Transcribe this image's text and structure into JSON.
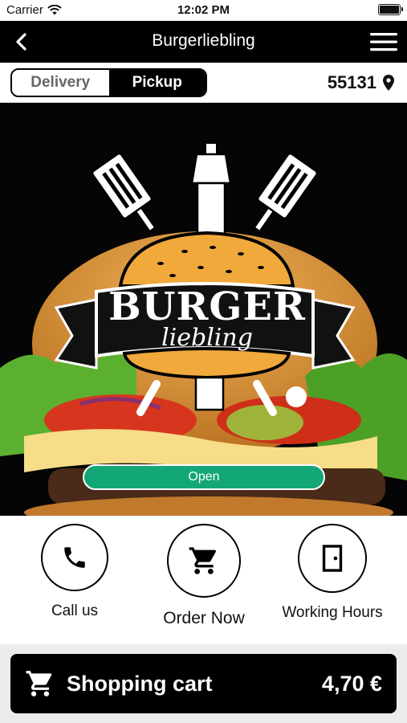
{
  "status_bar": {
    "carrier": "Carrier",
    "time": "12:02 PM"
  },
  "nav": {
    "title": "Burgerliebling"
  },
  "mode": {
    "delivery_label": "Delivery",
    "pickup_label": "Pickup",
    "selected": "Pickup",
    "zip": "55131"
  },
  "hero": {
    "logo_word": "BURGER",
    "logo_script": "liebling",
    "open_label": "Open"
  },
  "actions": {
    "call_label": "Call us",
    "order_label": "Order Now",
    "hours_label": "Working Hours"
  },
  "cart": {
    "label": "Shopping cart",
    "total": "4,70 €"
  },
  "colors": {
    "accent_green": "#13a777",
    "nav_bg": "#000000",
    "logo_bun": "#f0a93a"
  },
  "icons": [
    "wifi-icon",
    "battery-icon",
    "back-chevron-icon",
    "hamburger-menu-icon",
    "location-pin-icon",
    "phone-icon",
    "cart-icon",
    "door-icon"
  ]
}
